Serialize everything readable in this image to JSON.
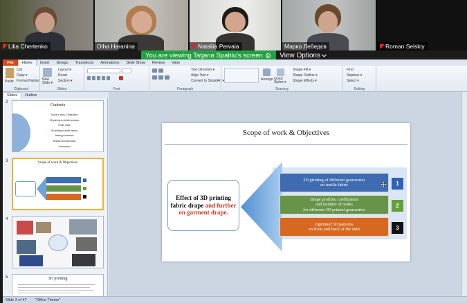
{
  "participants": [
    {
      "name": "Lilia Chertenko",
      "muted": true
    },
    {
      "name": "Olha Haranina",
      "muted": false
    },
    {
      "name": "Nataliia Pervaia",
      "muted": true
    },
    {
      "name": "Марко Лебедєв",
      "muted": false
    },
    {
      "name": "Roman Selskiy",
      "muted": true
    }
  ],
  "banner": {
    "text": "You are viewing Tatjana Spahiu's screen",
    "view_options": "View Options"
  },
  "ribbon": {
    "tabs": [
      "File",
      "Home",
      "Insert",
      "Design",
      "Transitions",
      "Animations",
      "Slide Show",
      "Review",
      "View"
    ],
    "active_tab": "Home",
    "groups": [
      "Clipboard",
      "Slides",
      "Font",
      "Paragraph",
      "Drawing",
      "Editing"
    ],
    "clipboard": {
      "paste": "Paste",
      "cut": "Cut",
      "copy": "Copy ▾",
      "format_painter": "Format Painter"
    },
    "slides": {
      "new_slide": "New Slide ▾",
      "layout": "Layout ▾",
      "reset": "Reset",
      "section": "Section ▾"
    },
    "paragraph": {
      "text_direction": "Text Direction ▾",
      "align_text": "Align Text ▾",
      "smartart": "Convert to SmartArt ▾"
    },
    "drawing": {
      "arrange": "Arrange",
      "quick_styles": "Quick Styles ▾",
      "shape_fill": "Shape Fill ▾",
      "shape_outline": "Shape Outline ▾",
      "shape_effects": "Shape Effects ▾"
    },
    "editing": {
      "find": "Find",
      "replace": "Replace ▾",
      "select": "Select ▾"
    }
  },
  "pane": {
    "tabs": [
      "Slides",
      "Outline"
    ],
    "thumbs": [
      {
        "num": "2",
        "title": "Contents",
        "items": [
          "Scope of work & Objectives",
          "3D printing on textile surfaces",
          "Textile drape",
          "3D printing of textile fabrics",
          "Testing procedures",
          "Results and discussion",
          "Conclusions"
        ]
      },
      {
        "num": "3",
        "title": "Scope of work & Objectives"
      },
      {
        "num": "4"
      },
      {
        "num": "5",
        "title": "3D printing"
      }
    ]
  },
  "status": {
    "slide": "Slide 3 of 47",
    "theme": "\"Office Theme\""
  },
  "slide": {
    "title": "Scope of work & Objectives",
    "left_box": {
      "line1": "Effect of 3D printing",
      "line2_black": "fabric drape",
      "line2_red": "and further",
      "line3_red": "on garment drape."
    },
    "rows": [
      {
        "lines": [
          "3D printing of different geometries",
          "on textile fabric"
        ],
        "number": "1",
        "color": "#3f6cb0",
        "num_bg": "#2f62b5",
        "num_fg": "#ffffff"
      },
      {
        "lines": [
          "Drape profiles, coefficients",
          "and number of nodes",
          "for different 3D printed geometries"
        ],
        "number": "2",
        "color": "#679449",
        "num_bg": "#64a03a",
        "num_fg": "#ffffff"
      },
      {
        "lines": [
          "Inprinted 3D patterns",
          "on front and back of the skirt"
        ],
        "number": "3",
        "color": "#d6691f",
        "num_bg": "#111111",
        "num_fg": "#ffffff"
      }
    ]
  }
}
